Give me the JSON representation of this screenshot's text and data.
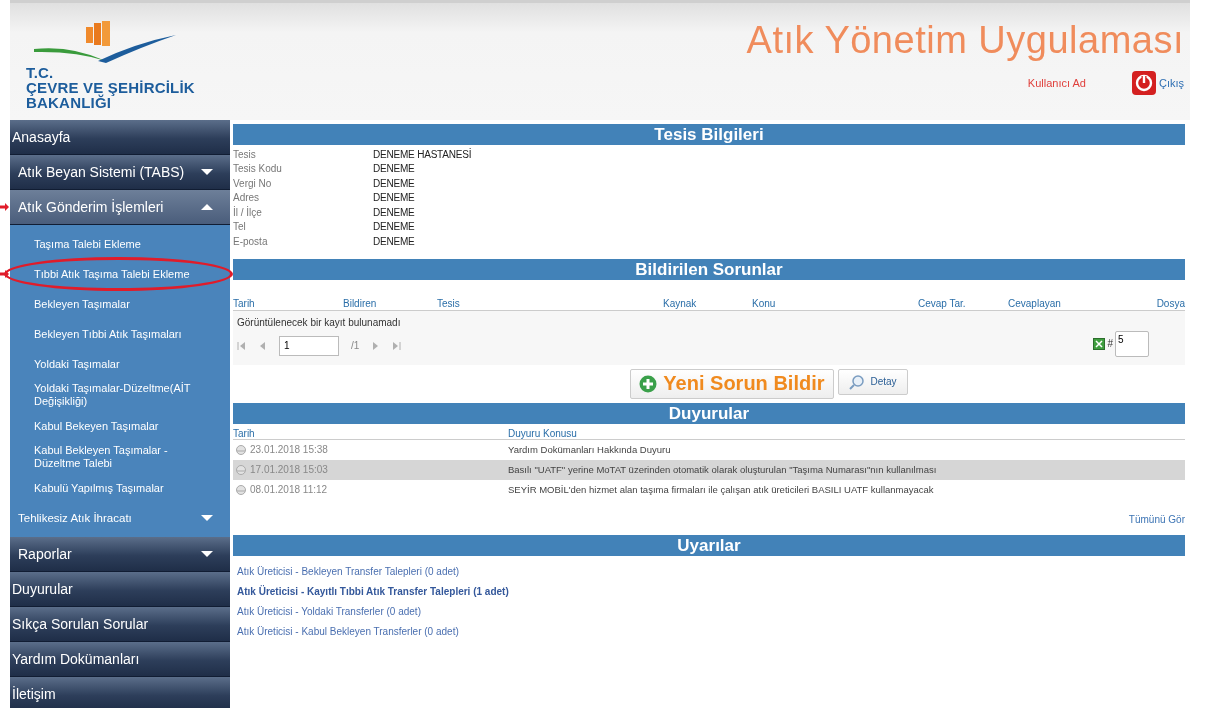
{
  "header": {
    "logo_lines": [
      "T.C.",
      "ÇEVRE VE ŞEHİRCİLİK",
      "BAKANLIĞI"
    ],
    "title": "Atık Yönetim Uygulaması",
    "user": "Kullanıcı Ad",
    "logout": "Çıkış"
  },
  "sidebar": {
    "items": [
      {
        "label": "Anasayfa",
        "kind": "link"
      },
      {
        "label": "Atık Beyan Sistemi (TABS)",
        "kind": "menu",
        "expanded": false,
        "marked": false
      },
      {
        "label": "Atık Gönderim İşlemleri",
        "kind": "menu",
        "expanded": true,
        "marked": true,
        "children": [
          {
            "label": "Taşıma Talebi Ekleme",
            "kind": "link",
            "circled": false,
            "marked": false
          },
          {
            "label": "Tıbbi Atık Taşıma Talebi Ekleme",
            "kind": "link",
            "circled": true,
            "marked": true
          },
          {
            "label": "Bekleyen Taşımalar",
            "kind": "link",
            "circled": false,
            "marked": false
          },
          {
            "label": "Bekleyen Tıbbi Atık Taşımaları",
            "kind": "link",
            "circled": false,
            "marked": false
          },
          {
            "label": "Yoldaki Taşımalar",
            "kind": "link",
            "circled": false,
            "marked": false
          },
          {
            "label": "Yoldaki Taşımalar-Düzeltme(AİT Değişikliği)",
            "kind": "link",
            "circled": false,
            "marked": false
          },
          {
            "label": "Kabul Bekeyen Taşımalar",
            "kind": "link",
            "circled": false,
            "marked": false
          },
          {
            "label": "Kabul Bekleyen Taşımalar - Düzeltme Talebi",
            "kind": "link",
            "circled": false,
            "marked": false
          },
          {
            "label": "Kabulü Yapılmış Taşımalar",
            "kind": "link",
            "circled": false,
            "marked": false
          },
          {
            "label": "Tehlikesiz Atık İhracatı",
            "kind": "menu",
            "expanded": false,
            "circled": false,
            "marked": false
          }
        ]
      },
      {
        "label": "Raporlar",
        "kind": "menu",
        "expanded": false,
        "marked": false
      },
      {
        "label": "Duyurular",
        "kind": "link"
      },
      {
        "label": "Sıkça Sorulan Sorular",
        "kind": "link"
      },
      {
        "label": "Yardım Dokümanları",
        "kind": "link"
      },
      {
        "label": "İletişim",
        "kind": "link"
      }
    ]
  },
  "facility": {
    "title": "Tesis Bilgileri",
    "fields": [
      {
        "label": "Tesis",
        "value": "DENEME HASTANESİ"
      },
      {
        "label": "Tesis Kodu",
        "value": "DENEME"
      },
      {
        "label": "Vergi No",
        "value": "DENEME"
      },
      {
        "label": "Adres",
        "value": "DENEME"
      },
      {
        "label": "İl / İlçe",
        "value": "DENEME"
      },
      {
        "label": "Tel",
        "value": "DENEME"
      },
      {
        "label": "E-posta",
        "value": "DENEME"
      }
    ]
  },
  "issues": {
    "title": "Bildirilen Sorunlar",
    "columns": [
      "Tarih",
      "Bildiren",
      "Tesis",
      "Kaynak",
      "Konu",
      "Cevap Tar.",
      "Cevaplayan",
      "Dosya"
    ],
    "empty_message": "Görüntülenecek bir kayıt bulunamadı",
    "pager": {
      "page": "1",
      "total": "/1",
      "size_label": "#",
      "size": "5"
    },
    "buttons": [
      {
        "label": "Yeni Sorun Bildir",
        "kind": "add"
      },
      {
        "label": "Detay",
        "kind": "detail"
      }
    ]
  },
  "announcements": {
    "title": "Duyurular",
    "columns": [
      "Tarih",
      "Duyuru Konusu"
    ],
    "rows": [
      {
        "date": "23.01.2018 15:38",
        "subject": "Yardım Dokümanları Hakkında Duyuru",
        "selected": false
      },
      {
        "date": "17.01.2018 15:03",
        "subject": "Basılı \"UATF\" yerine MoTAT üzerinden otomatik olarak oluşturulan \"Taşıma Numarası\"nın kullanılması",
        "selected": true
      },
      {
        "date": "08.01.2018 11:12",
        "subject": "SEYİR MOBİL'den hizmet alan taşıma firmaları ile çalışan atık üreticileri BASILI UATF kullanmayacak",
        "selected": false
      }
    ],
    "see_all": "Tümünü Gör"
  },
  "warnings": {
    "title": "Uyarılar",
    "links": [
      {
        "label": "Atık Üreticisi - Bekleyen Transfer Talepleri (0 adet)",
        "bold": false
      },
      {
        "label": "Atık Üreticisi - Kayıtlı Tıbbi Atık Transfer Talepleri (1 adet)",
        "bold": true
      },
      {
        "label": "Atık Üreticisi - Yoldaki Transferler (0 adet)",
        "bold": false
      },
      {
        "label": "Atık Üreticisi - Kabul Bekleyen Transferler (0 adet)",
        "bold": false
      }
    ]
  }
}
